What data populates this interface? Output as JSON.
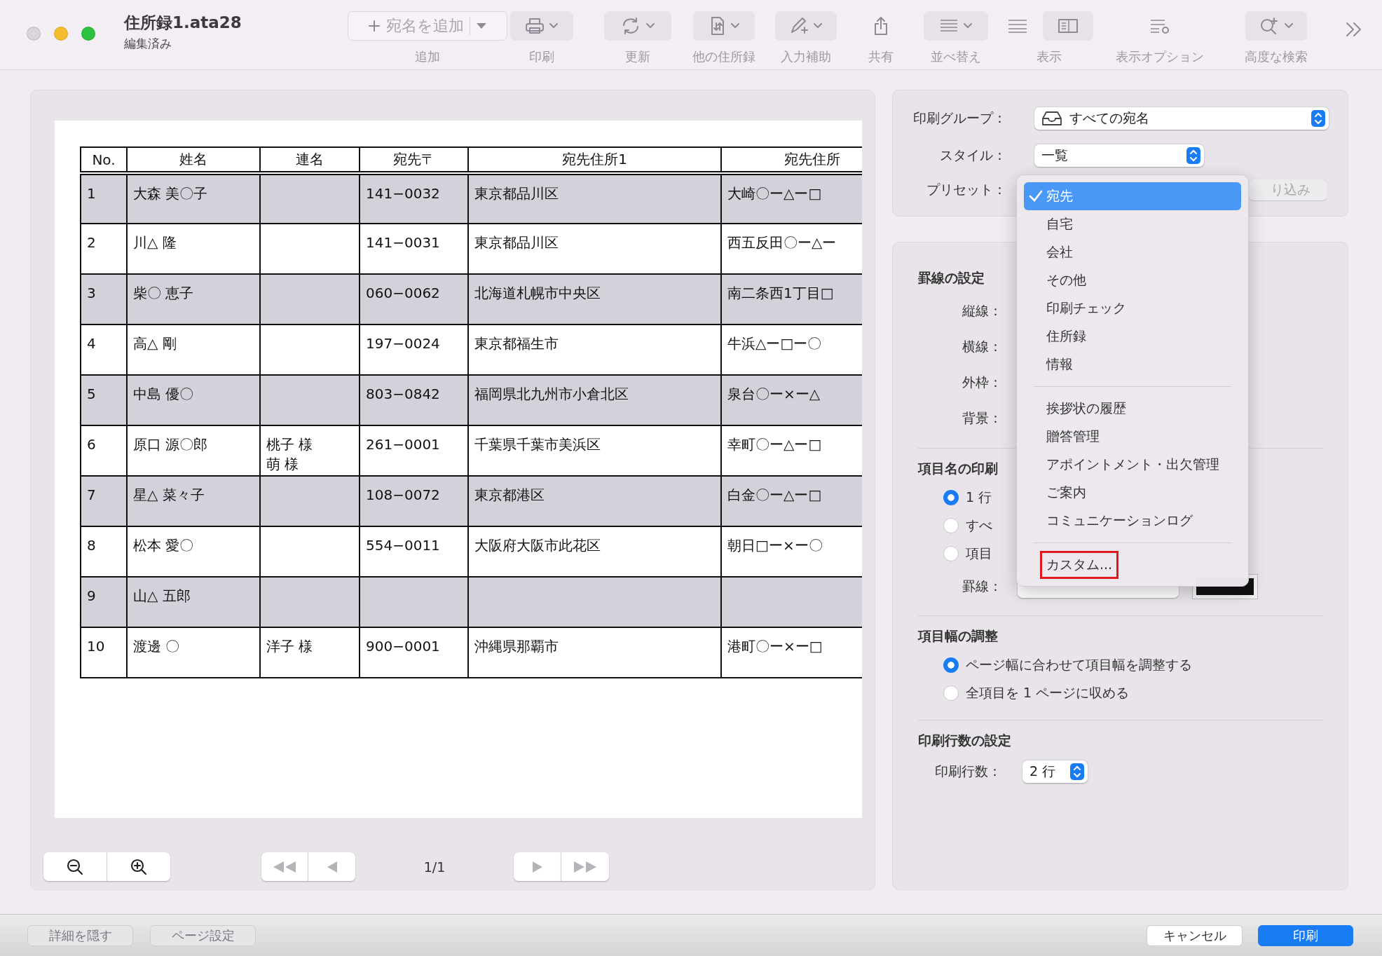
{
  "window": {
    "title": "住所録1.ata28",
    "subtitle": "編集済み"
  },
  "toolbar": {
    "items": [
      {
        "kind": "add",
        "label": "追加",
        "text": "宛名を追加"
      },
      {
        "kind": "print",
        "label": "印刷"
      },
      {
        "kind": "refresh",
        "label": "更新"
      },
      {
        "kind": "other",
        "label": "他の住所録"
      },
      {
        "kind": "assist",
        "label": "入力補助"
      },
      {
        "kind": "share",
        "label": "共有"
      },
      {
        "kind": "sort",
        "label": "並べ替え"
      },
      {
        "kind": "view",
        "label": "表示"
      },
      {
        "kind": "view_options",
        "label": "表示オプション"
      },
      {
        "kind": "search",
        "label": "高度な検索"
      }
    ]
  },
  "preview": {
    "table": {
      "header": {
        "no": "No.",
        "name": "姓名",
        "joint_name": "連名",
        "zip": "宛先〒",
        "address_1": "宛先住所1",
        "column_6": "宛先住所"
      },
      "rows": [
        {
          "no": "1",
          "name": "大森 美〇子",
          "zip": "141−0032",
          "address_1": "東京都品川区",
          "column_6": "大崎〇ー△ー□"
        },
        {
          "no": "2",
          "name": "川△ 隆",
          "zip": "141−0031",
          "address_1": "東京都品川区",
          "column_6": "西五反田〇ー△ー"
        },
        {
          "no": "3",
          "name": "柴〇 恵子",
          "zip": "060−0062",
          "address_1": "北海道札幌市中央区",
          "column_6": "南二条西1丁目□"
        },
        {
          "no": "4",
          "name": "高△ 剛",
          "zip": "197−0024",
          "address_1": "東京都福生市",
          "column_6": "牛浜△ー□ー〇"
        },
        {
          "no": "5",
          "name": "中島 優〇",
          "zip": "803−0842",
          "address_1": "福岡県北九州市小倉北区",
          "column_6": "泉台〇ー×ー△"
        },
        {
          "no": "6",
          "name": "原口 源〇郎",
          "joint_name": [
            "桃子 様",
            "萌 様"
          ],
          "zip": "261−0001",
          "address_1": "千葉県千葉市美浜区",
          "column_6": "幸町〇ー△ー□"
        },
        {
          "no": "7",
          "name": "星△ 菜々子",
          "zip": "108−0072",
          "address_1": "東京都港区",
          "column_6": "白金〇ー△ー□"
        },
        {
          "no": "8",
          "name": "松本 愛〇",
          "zip": "554−0011",
          "address_1": "大阪府大阪市此花区",
          "column_6": "朝日□ー×ー〇"
        },
        {
          "no": "9",
          "name": "山△ 五郎"
        },
        {
          "no": "10",
          "name": "渡邊 〇",
          "joint_name": "洋子 様",
          "zip": "900−0001",
          "address_1": "沖縄県那覇市",
          "column_6": "港町〇ー×ー□"
        }
      ]
    },
    "page_indicator": "1/1"
  },
  "settings": {
    "print_group": {
      "label": "印刷グループ：",
      "value": "すべての宛名"
    },
    "style": {
      "label": "スタイル：",
      "value": "一覧"
    },
    "preset": {
      "label": "プリセット：",
      "filter_placeholder": "り込み"
    },
    "sections": [
      {
        "title": "罫線の設定",
        "rows": [
          "縦線：",
          "横線：",
          "外枠：",
          "背景："
        ]
      },
      {
        "title": "項目名の印刷",
        "radios": [
          {
            "label": "1 行",
            "selected": true
          },
          {
            "label": "すべ",
            "selected": false
          },
          {
            "label": "項目",
            "selected": false
          }
        ],
        "line_label": "罫線："
      },
      {
        "title": "項目幅の調整",
        "radios": [
          {
            "label": "ページ幅に合わせて項目幅を調整する",
            "selected": true
          },
          {
            "label": "全項目を 1 ページに収める",
            "selected": false
          }
        ]
      },
      {
        "title": "印刷行数の設定",
        "count_label": "印刷行数：",
        "count_value": "2 行"
      }
    ]
  },
  "preset_menu": {
    "groups": [
      [
        {
          "label": "宛先",
          "selected": true
        },
        {
          "label": "自宅",
          "selected": false
        },
        {
          "label": "会社",
          "selected": false
        },
        {
          "label": "その他",
          "selected": false
        },
        {
          "label": "印刷チェック",
          "selected": false
        },
        {
          "label": "住所録",
          "selected": false
        },
        {
          "label": "情報",
          "selected": false
        }
      ],
      [
        {
          "label": "挨拶状の履歴",
          "selected": false
        },
        {
          "label": "贈答管理",
          "selected": false
        },
        {
          "label": "アポイントメント・出欠管理",
          "selected": false
        },
        {
          "label": "ご案内",
          "selected": false
        },
        {
          "label": "コミュニケーションログ",
          "selected": false
        }
      ],
      [
        {
          "label": "カスタム...",
          "selected": false,
          "outlined": true
        }
      ]
    ]
  },
  "footer": {
    "left_buttons": [
      "詳細を隠す",
      "ページ設定"
    ],
    "cancel": "キャンセル",
    "print": "印刷"
  }
}
